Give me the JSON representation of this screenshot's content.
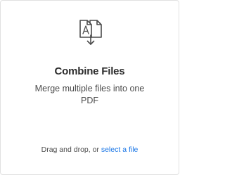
{
  "card": {
    "title": "Combine Files",
    "description": "Merge multiple files into one PDF",
    "icon": "combine-files-icon",
    "footer": {
      "text": "Drag and drop, or ",
      "link_label": "select a file"
    }
  },
  "colors": {
    "accent": "#1473e6",
    "icon_stroke": "#4a4a4a",
    "border": "#e1e1e1"
  }
}
